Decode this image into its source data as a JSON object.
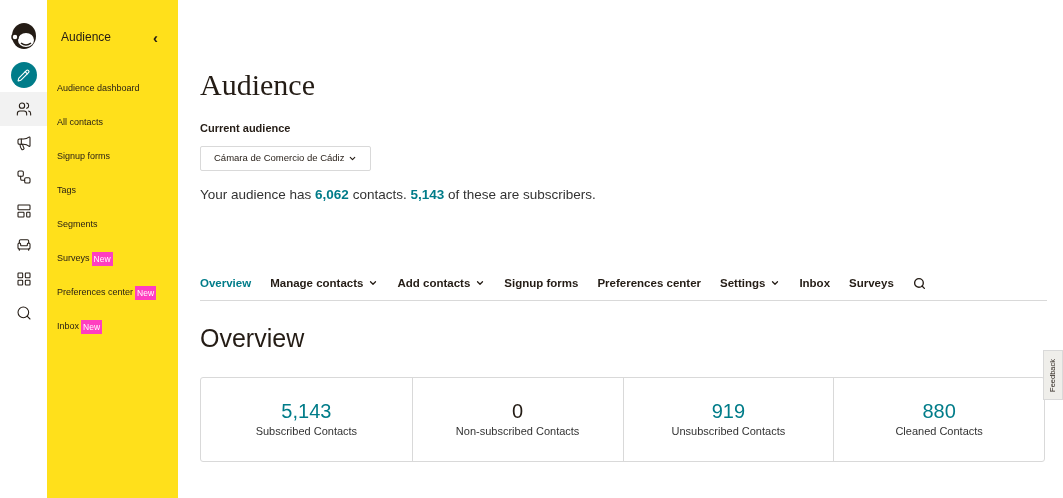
{
  "rail": [
    {
      "kind": "create",
      "selected": false
    },
    {
      "kind": "contacts",
      "selected": true
    },
    {
      "kind": "campaigns",
      "selected": false
    },
    {
      "kind": "automations",
      "selected": false
    },
    {
      "kind": "website",
      "selected": false
    },
    {
      "kind": "integrations",
      "selected": false
    },
    {
      "kind": "apps",
      "selected": false
    },
    {
      "kind": "search",
      "selected": false
    }
  ],
  "sidebar": {
    "title": "Audience",
    "collapse": "‹",
    "items": [
      {
        "label": "Audience dashboard"
      },
      {
        "label": "All contacts"
      },
      {
        "label": "Signup forms"
      },
      {
        "label": "Tags"
      },
      {
        "label": "Segments"
      },
      {
        "label": "Surveys",
        "badge": "New"
      },
      {
        "label": "Preferences center",
        "badge": "New"
      },
      {
        "label": "Inbox",
        "badge": "New"
      }
    ]
  },
  "page": {
    "title": "Audience",
    "audience_label": "Current audience",
    "audience_select": "Cámara de Comercio de Cádiz",
    "summary": "Your audience has **6,062** contacts. **5,143** of these are subscribers."
  },
  "tabs": [
    {
      "label": "Overview",
      "selected": true,
      "dropdown": false
    },
    {
      "label": "Manage contacts",
      "selected": false,
      "dropdown": true
    },
    {
      "label": "Add contacts",
      "selected": false,
      "dropdown": true
    },
    {
      "label": "Signup forms",
      "selected": false,
      "dropdown": false
    },
    {
      "label": "Preferences center",
      "selected": false,
      "dropdown": false
    },
    {
      "label": "Settings",
      "selected": false,
      "dropdown": true
    },
    {
      "label": "Inbox",
      "selected": false,
      "dropdown": false
    },
    {
      "label": "Surveys",
      "selected": false,
      "dropdown": false
    }
  ],
  "overview": {
    "title": "Overview",
    "stats": [
      {
        "value": "5,143",
        "label": "Subscribed Contacts",
        "color": "#007c89"
      },
      {
        "value": "0",
        "label": "Non-subscribed Contacts",
        "color": "#241c15"
      },
      {
        "value": "919",
        "label": "Unsubscribed Contacts",
        "color": "#007c89"
      },
      {
        "value": "880",
        "label": "Cleaned Contacts",
        "color": "#007c89"
      }
    ]
  },
  "feedback": "Feedback"
}
